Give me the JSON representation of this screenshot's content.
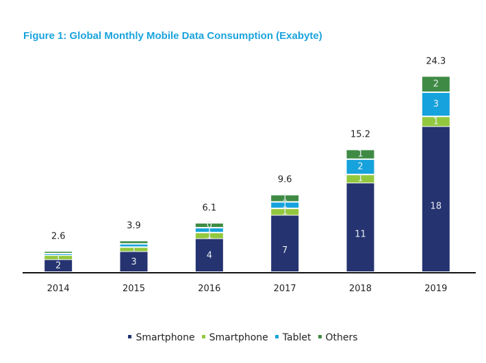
{
  "chart_data": {
    "type": "bar",
    "stacked": true,
    "title": "Figure 1: Global Monthly Mobile Data Consumption (Exabyte)",
    "xlabel": "",
    "ylabel": "",
    "ylim": [
      0,
      25
    ],
    "grid": false,
    "legend_position": "bottom",
    "categories": [
      "2014",
      "2015",
      "2016",
      "2017",
      "2018",
      "2019"
    ],
    "totals": [
      2.6,
      3.9,
      6.1,
      9.6,
      15.2,
      24.3
    ],
    "total_labels": [
      "2.6",
      "3.9",
      "6.1",
      "9.6",
      "15.2",
      "24.3"
    ],
    "series": [
      {
        "name": "Smartphone",
        "color": "#253370",
        "values": [
          1.5,
          2.5,
          4.1,
          7.0,
          11.0,
          18.0
        ],
        "labels": [
          "2",
          "3",
          "4",
          "7",
          "11",
          "18"
        ]
      },
      {
        "name": "Smartphone",
        "color": "#92c83e",
        "values": [
          0.6,
          0.6,
          0.8,
          0.9,
          1.1,
          1.3
        ],
        "labels": [
          "1",
          "1",
          "1",
          "1",
          "1",
          "1"
        ]
      },
      {
        "name": "Tablet",
        "color": "#16a2dc",
        "values": [
          0.2,
          0.4,
          0.6,
          0.8,
          1.9,
          3.0
        ],
        "labels": [
          "",
          "",
          "1",
          "1",
          "2",
          "3"
        ]
      },
      {
        "name": "Others",
        "color": "#3f8b45",
        "values": [
          0.3,
          0.4,
          0.6,
          0.9,
          1.2,
          2.0
        ],
        "labels": [
          "",
          "",
          "0",
          "1",
          "1",
          "2"
        ]
      }
    ]
  },
  "legend": [
    {
      "label": "Smartphone",
      "color": "#253370"
    },
    {
      "label": "Smartphone",
      "color": "#92c83e"
    },
    {
      "label": "Tablet",
      "color": "#16a2dc"
    },
    {
      "label": "Others",
      "color": "#3f8b45"
    }
  ]
}
